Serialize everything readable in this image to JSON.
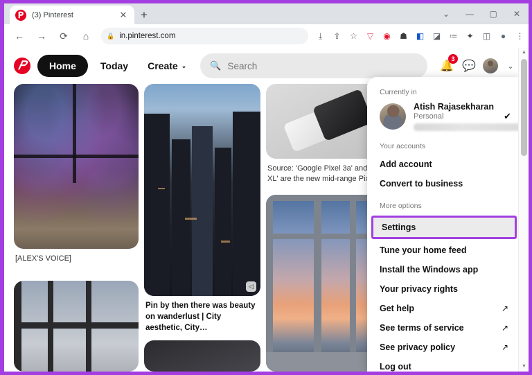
{
  "window": {
    "controls": {
      "tab_search": "⌄",
      "minimize": "—",
      "maximize": "▢",
      "close": "✕"
    }
  },
  "browser": {
    "tab": {
      "favicon": "pinterest-favicon",
      "title": "(3) Pinterest",
      "close": "✕"
    },
    "new_tab": "+",
    "nav": {
      "back": "←",
      "forward": "→",
      "reload": "⟳",
      "home": "⌂"
    },
    "omnibox": {
      "lock_icon": "lock-icon",
      "url": "in.pinterest.com"
    },
    "toolbar_icons": [
      {
        "name": "install-app-icon",
        "glyph": "⤓"
      },
      {
        "name": "share-icon",
        "glyph": "⇪"
      },
      {
        "name": "bookmark-star-icon",
        "glyph": "☆"
      },
      {
        "name": "pocket-icon",
        "glyph": "▽"
      },
      {
        "name": "opera-icon",
        "glyph": "◉"
      },
      {
        "name": "ghostery-icon",
        "glyph": "☗"
      },
      {
        "name": "grammarly-icon",
        "glyph": "◧"
      },
      {
        "name": "dark-reader-icon",
        "glyph": "◪"
      },
      {
        "name": "reading-list-icon",
        "glyph": "≔"
      },
      {
        "name": "extensions-puzzle-icon",
        "glyph": "✦"
      },
      {
        "name": "side-panel-icon",
        "glyph": "◫"
      },
      {
        "name": "profile-avatar-icon",
        "glyph": "●"
      },
      {
        "name": "chrome-menu-icon",
        "glyph": "⋮"
      }
    ]
  },
  "pinterest": {
    "logo": "pinterest-logo",
    "nav": {
      "home": "Home",
      "today": "Today",
      "create": "Create",
      "create_caret": "⌄"
    },
    "search": {
      "icon": "search-icon",
      "placeholder": "Search"
    },
    "header_right": {
      "notifications_icon": "bell-icon",
      "notifications_count": "3",
      "messages_icon": "chat-bubble-icon",
      "avatar": "user-avatar",
      "account_caret": "⌄"
    }
  },
  "feed": {
    "pins": [
      {
        "art": "bedroom-city-night",
        "caption": "[ALEX'S VOICE]",
        "caption_style": "plain"
      },
      {
        "art": "city-skyline-dusk",
        "caption": "Pin by then there was beauty on wanderlust | City aesthetic, City…",
        "caption_style": "bold"
      },
      {
        "art": "google-pixel-phones",
        "caption": "Source: 'Google Pixel 3a' and '3a XL' are the new mid-range Pixe",
        "caption_style": "plain"
      },
      {
        "art": "window-grid-dusk",
        "caption": "",
        "caption_style": "plain"
      },
      {
        "art": "corner-window-sunset",
        "caption": "",
        "caption_style": "plain"
      },
      {
        "art": "dark-structure",
        "caption": "",
        "caption_style": "plain"
      }
    ]
  },
  "dropdown": {
    "currently_in_label": "Currently in",
    "account": {
      "avatar": "account-avatar",
      "name": "Atish Rajasekharan",
      "type": "Personal",
      "email_redacted": "",
      "check_icon": "✔"
    },
    "your_accounts_label": "Your accounts",
    "account_actions": [
      {
        "label": "Add account",
        "external": ""
      },
      {
        "label": "Convert to business",
        "external": ""
      }
    ],
    "more_options_label": "More options",
    "highlighted_item": "Settings",
    "options": [
      {
        "label": "Tune your home feed",
        "external": ""
      },
      {
        "label": "Install the Windows app",
        "external": ""
      },
      {
        "label": "Your privacy rights",
        "external": ""
      },
      {
        "label": "Get help",
        "external": "↗"
      },
      {
        "label": "See terms of service",
        "external": "↗"
      },
      {
        "label": "See privacy policy",
        "external": "↗"
      },
      {
        "label": "Log out",
        "external": ""
      }
    ]
  },
  "scrollbar": {
    "up_arrow": "▲",
    "down_arrow": "▼"
  },
  "colors": {
    "annotation_purple": "#a33ee0",
    "pinterest_red": "#e60023",
    "highlight_fill": "#ebebeb"
  }
}
